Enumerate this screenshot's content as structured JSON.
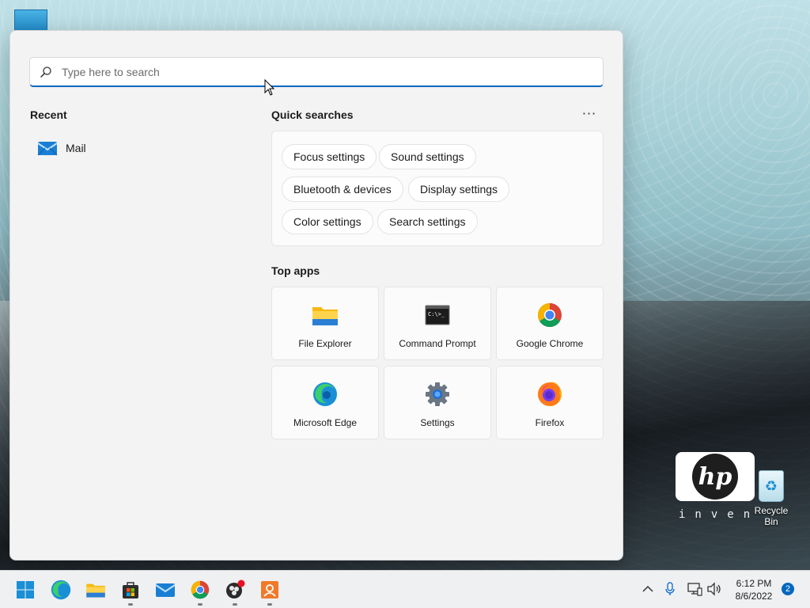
{
  "search": {
    "placeholder": "Type here to search",
    "value": ""
  },
  "recent": {
    "title": "Recent",
    "items": [
      {
        "label": "Mail",
        "icon": "mail-icon"
      }
    ]
  },
  "quick_searches": {
    "title": "Quick searches",
    "more_label": "···",
    "chips": [
      "Focus settings",
      "Sound settings",
      "Bluetooth & devices",
      "Display settings",
      "Color settings",
      "Search settings"
    ]
  },
  "top_apps": {
    "title": "Top apps",
    "apps": [
      {
        "label": "File Explorer",
        "icon": "folder-icon"
      },
      {
        "label": "Command Prompt",
        "icon": "terminal-icon"
      },
      {
        "label": "Google Chrome",
        "icon": "chrome-icon"
      },
      {
        "label": "Microsoft Edge",
        "icon": "edge-icon"
      },
      {
        "label": "Settings",
        "icon": "gear-icon"
      },
      {
        "label": "Firefox",
        "icon": "firefox-icon"
      }
    ]
  },
  "desktop": {
    "recycle_bin_label": "Recycle Bin",
    "hp_logo_text": "hp",
    "hp_tagline": "inven"
  },
  "taskbar": {
    "apps": [
      "windows-start-icon",
      "edge-icon",
      "file-explorer-icon",
      "store-icon",
      "mail-icon",
      "chrome-icon",
      "obs-icon",
      "app-orange-icon"
    ],
    "time": "6:12 PM",
    "date": "8/6/2022",
    "notification_count": "2"
  },
  "colors": {
    "accent": "#0067c0",
    "panel_bg": "#f3f3f3"
  }
}
